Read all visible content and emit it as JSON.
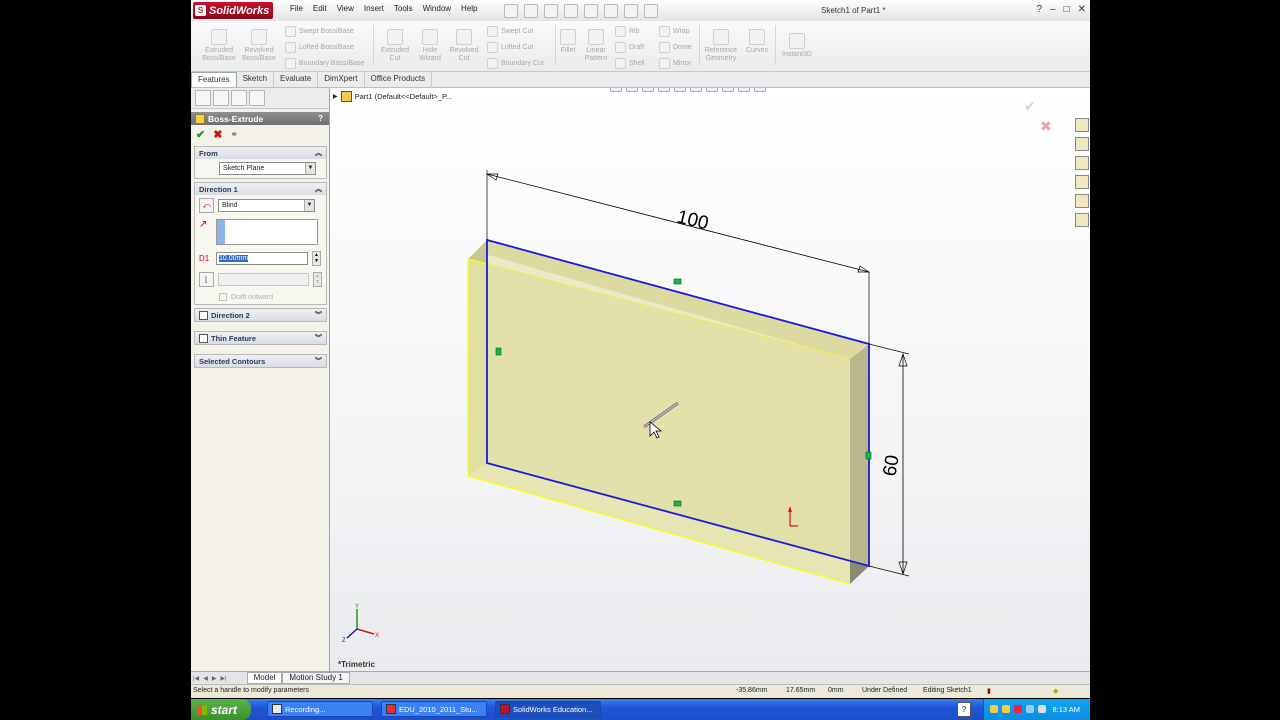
{
  "app": {
    "logo_text": "SolidWorks",
    "menus": [
      "File",
      "Edit",
      "View",
      "Insert",
      "Tools",
      "Window",
      "Help"
    ],
    "window_title": "Sketch1 of Part1 *"
  },
  "command_manager": {
    "extruded_boss": "Extruded Boss/Base",
    "revolved_boss": "Revolved Boss/Base",
    "swept_boss": "Swept Boss/Base",
    "lofted_boss": "Lofted Boss/Base",
    "boundary_boss": "Boundary Boss/Base",
    "extruded_cut": "Extruded Cut",
    "hole_wizard": "Hole Wizard",
    "revolved_cut": "Revolved Cut",
    "swept_cut": "Swept Cut",
    "lofted_cut": "Lofted Cut",
    "boundary_cut": "Boundary Cut",
    "fillet": "Fillet",
    "linear_pattern": "Linear Pattern",
    "rib": "Rib",
    "draft": "Draft",
    "shell": "Shell",
    "wrap": "Wrap",
    "dome": "Dome",
    "mirror": "Mirror",
    "reference_geometry": "Reference Geometry",
    "curves": "Curves",
    "instant3d": "Instant3D"
  },
  "tabs": [
    "Features",
    "Sketch",
    "Evaluate",
    "DimXpert",
    "Office Products"
  ],
  "property_manager": {
    "title": "Boss-Extrude",
    "help": "?",
    "from_label": "From",
    "from_value": "Sketch Plane",
    "direction1_label": "Direction 1",
    "end_condition": "Blind",
    "depth_value": "10.00mm",
    "draft_outward": "Draft outward",
    "direction2_label": "Direction 2",
    "thin_feature_label": "Thin Feature",
    "selected_contours_label": "Selected Contours"
  },
  "graphics": {
    "tree_item": "Part1  (Default<<Default>_P...",
    "dimension_width": "100",
    "dimension_height": "60",
    "view_orientation": "*Trimetric"
  },
  "bottom_tabs": [
    "Model",
    "Motion Study 1"
  ],
  "status_bar": {
    "message": "Select a handle to modify parameters",
    "x": "-35.86mm",
    "y": "17.65mm",
    "z": "0mm",
    "state": "Under Defined",
    "editing": "Editing Sketch1"
  },
  "taskbar": {
    "start": "start",
    "items": [
      "Recording...",
      "EDU_2010_2011_Stu...",
      "SolidWorks Education..."
    ],
    "time": "8:13 AM"
  },
  "colors": {
    "body_face": "#e6e5a6",
    "sketch_edge": "#1a1adb",
    "selection_edge": "#ffff00",
    "xp_blue": "#1f56d6"
  }
}
